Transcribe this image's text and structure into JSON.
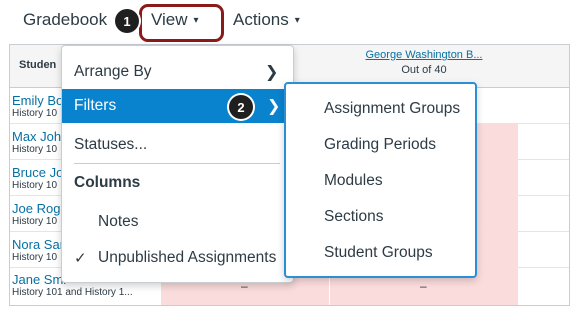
{
  "toolbar": {
    "gradebook_label": "Gradebook",
    "view_label": "View",
    "actions_label": "Actions",
    "caret": "▾"
  },
  "badges": {
    "one": "1",
    "two": "2"
  },
  "grid": {
    "student_header": "Studen",
    "assignment_header_title": "George Washington B...",
    "assignment_header_points": "Out of 40",
    "rows": [
      {
        "name": "Emily Bo",
        "section": "History 10"
      },
      {
        "name": "Max Joh",
        "section": "History 10"
      },
      {
        "name": "Bruce Jo",
        "section": "History 10"
      },
      {
        "name": "Joe Roge",
        "section": "History 10"
      },
      {
        "name": "Nora Sar",
        "section": "History 10"
      },
      {
        "name": "Jane Smi",
        "section": "History 101 and History 1..."
      }
    ],
    "dash": "–"
  },
  "view_menu": {
    "arrange_by": "Arrange By",
    "filters": "Filters",
    "statuses": "Statuses...",
    "columns_heading": "Columns",
    "notes": "Notes",
    "unpublished": "Unpublished Assignments",
    "checkmark": "✓",
    "chevron": "❯"
  },
  "filters_submenu": {
    "items": [
      "Assignment Groups",
      "Grading Periods",
      "Modules",
      "Sections",
      "Student Groups"
    ]
  },
  "colors": {
    "highlight": "#0a83cf",
    "link": "#0770a3",
    "outline": "#8a1b1b",
    "pink_cell": "#fbdcdc"
  }
}
